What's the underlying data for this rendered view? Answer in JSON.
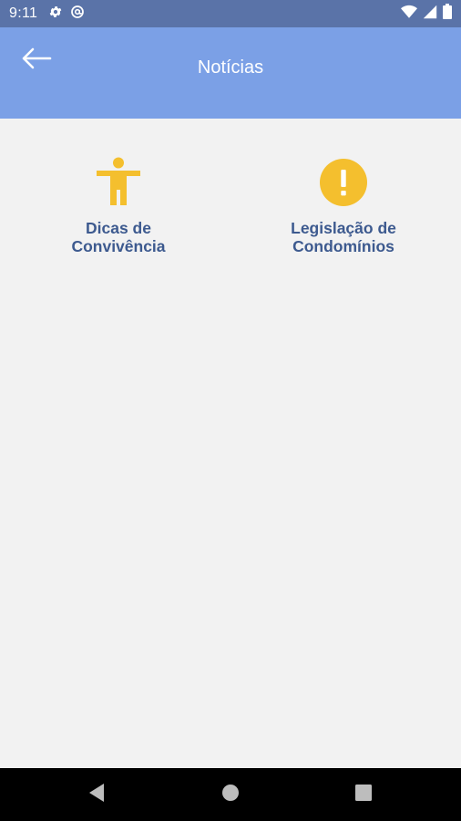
{
  "status_bar": {
    "time": "9:11",
    "left_icons": [
      "gear-icon",
      "at-sync-icon"
    ],
    "right_icons": [
      "wifi-icon",
      "cell-signal-icon",
      "battery-icon"
    ]
  },
  "app_bar": {
    "title": "Notícias",
    "back_icon": "arrow-left-icon",
    "color": "#7ba0e6"
  },
  "menu": {
    "items": [
      {
        "line1": "Dicas de",
        "line2": "Convivência",
        "icon": "accessibility-person-icon"
      },
      {
        "line1": "Legislação de",
        "line2": "Condomínios",
        "icon": "exclamation-circle-icon"
      }
    ],
    "icon_color": "#f4bf2e",
    "label_color": "#3d5a8f"
  },
  "nav_bar": {
    "icons": [
      "back-triangle-icon",
      "home-circle-icon",
      "recents-square-icon"
    ]
  }
}
